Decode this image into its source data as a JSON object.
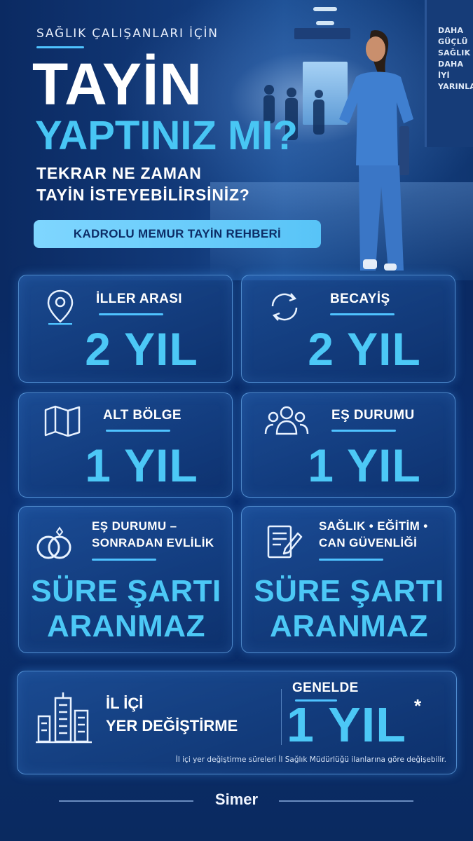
{
  "header": {
    "kicker": "SAĞLIK ÇALIŞANLARI İÇİN",
    "title_line1": "TAYİN",
    "title_line2": "YAPTINIZ MI?",
    "subtitle_line1": "TEKRAR NE ZAMAN",
    "subtitle_line2": "TAYİN İSTEYEBİLİRSİNİZ?",
    "badge": "KADROLU MEMUR TAYİN REHBERİ"
  },
  "wall_sign": [
    "DAHA",
    "GÜÇLÜ",
    "SAĞLIK",
    "DAHA İYİ",
    "YARINLAR"
  ],
  "cards": [
    {
      "label": "İLLER ARASI",
      "value": "2 YIL",
      "icon": "location-pin-icon"
    },
    {
      "label": "BECAYİŞ",
      "value": "2 YIL",
      "icon": "swap-arrows-icon"
    },
    {
      "label": "ALT BÖLGE",
      "value": "1 YIL",
      "icon": "map-icon"
    },
    {
      "label": "EŞ DURUMU",
      "value": "1 YIL",
      "icon": "people-icon"
    },
    {
      "label_line1": "EŞ DURUMU –",
      "label_line2": "SONRADAN EVLİLİK",
      "value_line1": "SÜRE ŞARTI",
      "value_line2": "ARANMAZ",
      "icon": "wedding-rings-icon"
    },
    {
      "label_line1": "SAĞLIK • EĞİTİM •",
      "label_line2": "CAN GÜVENLİĞİ",
      "value_line1": "SÜRE ŞARTI",
      "value_line2": "ARANMAZ",
      "icon": "document-pen-icon"
    }
  ],
  "bottom": {
    "label_line1": "İL İÇİ",
    "label_line2": "YER DEĞİŞTİRME",
    "pre_value": "GENELDE",
    "value": "1 YIL",
    "asterisk": "*",
    "footnote": "İl içi yer değiştirme süreleri İl Sağlık Müdürlüğü ilanlarına göre değişebilir.",
    "icon": "buildings-icon"
  },
  "footer": {
    "brand": "Simer"
  },
  "colors": {
    "accent": "#4cc8f6",
    "background": "#0c2c66",
    "badge": "#7fd6ff"
  }
}
